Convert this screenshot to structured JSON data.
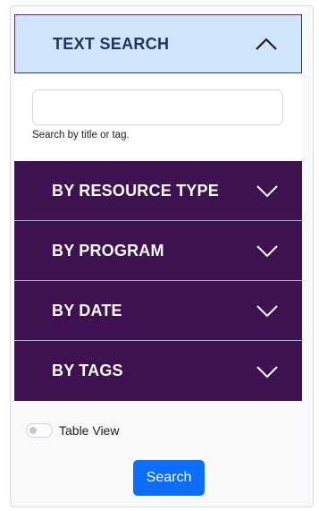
{
  "accordion": {
    "open_section": {
      "title": "TEXT SEARCH",
      "icon": "chevron-up-icon",
      "search": {
        "value": "",
        "placeholder": "",
        "helper": "Search by title or tag."
      }
    },
    "sections": [
      {
        "title": "BY RESOURCE TYPE",
        "icon": "chevron-down-icon"
      },
      {
        "title": "BY PROGRAM",
        "icon": "chevron-down-icon"
      },
      {
        "title": "BY DATE",
        "icon": "chevron-down-icon"
      },
      {
        "title": "BY TAGS",
        "icon": "chevron-down-icon"
      }
    ]
  },
  "table_view": {
    "label": "Table View",
    "enabled": false
  },
  "search_button": {
    "label": "Search"
  },
  "colors": {
    "open_header_bg": "#d0e4fb",
    "open_header_text": "#1b3566",
    "section_bg": "#3e1151",
    "button_bg": "#0d6efd"
  }
}
